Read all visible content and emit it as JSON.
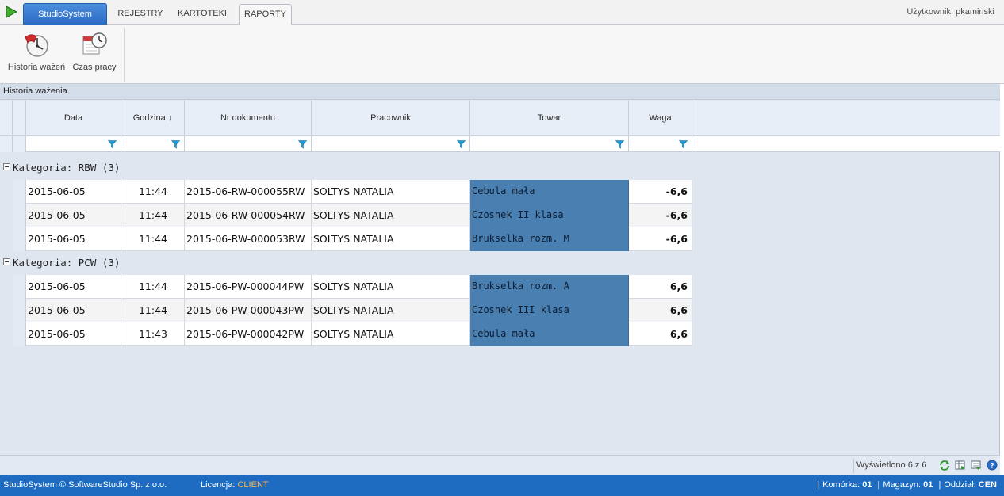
{
  "app": {
    "tabs": {
      "app_label": "StudioSystem",
      "rejestry": "REJESTRY",
      "kartoteki": "KARTOTEKI",
      "raporty": "RAPORTY"
    },
    "user_label": "Użytkownik: pkaminski"
  },
  "ribbon": {
    "historia_label": "Historia ważeń",
    "czas_label": "Czas pracy"
  },
  "panel": {
    "title": "Historia ważenia"
  },
  "grid": {
    "columns": {
      "data": "Data",
      "godzina": "Godzina ↓",
      "nr_dokumentu": "Nr dokumentu",
      "pracownik": "Pracownik",
      "towar": "Towar",
      "waga": "Waga"
    },
    "groups": [
      {
        "label": "Kategoria: RBW (3)",
        "rows": [
          {
            "data": "2015-06-05",
            "godzina": "11:44",
            "nr": "2015-06-RW-000055RW",
            "pracownik": "SOLTYS NATALIA",
            "towar": "Cebula mała",
            "waga": "-6,6"
          },
          {
            "data": "2015-06-05",
            "godzina": "11:44",
            "nr": "2015-06-RW-000054RW",
            "pracownik": "SOLTYS NATALIA",
            "towar": "Czosnek II klasa",
            "waga": "-6,6"
          },
          {
            "data": "2015-06-05",
            "godzina": "11:44",
            "nr": "2015-06-RW-000053RW",
            "pracownik": "SOLTYS NATALIA",
            "towar": "Brukselka rozm. M",
            "waga": "-6,6"
          }
        ]
      },
      {
        "label": "Kategoria: PCW (3)",
        "rows": [
          {
            "data": "2015-06-05",
            "godzina": "11:44",
            "nr": "2015-06-PW-000044PW",
            "pracownik": "SOLTYS NATALIA",
            "towar": "Brukselka rozm. A",
            "waga": "6,6"
          },
          {
            "data": "2015-06-05",
            "godzina": "11:44",
            "nr": "2015-06-PW-000043PW",
            "pracownik": "SOLTYS NATALIA",
            "towar": "Czosnek III klasa",
            "waga": "6,6"
          },
          {
            "data": "2015-06-05",
            "godzina": "11:43",
            "nr": "2015-06-PW-000042PW",
            "pracownik": "SOLTYS NATALIA",
            "towar": "Cebula mała",
            "waga": "6,6"
          }
        ]
      }
    ],
    "shown_label": "Wyświetlono 6 z 6"
  },
  "footer": {
    "copyright": "StudioSystem © SoftwareStudio Sp. z o.o.",
    "licencja_label": "Licencja:",
    "licencja_value": "CLIENT",
    "komorka_label": "Komórka:",
    "komorka_value": "01",
    "magazyn_label": "Magazyn:",
    "magazyn_value": "01",
    "oddzial_label": "Oddział:",
    "oddzial_value": "CEN"
  },
  "colors": {
    "accent": "#1d6cc2",
    "towar_highlight": "#4a7fb2",
    "licencja_value": "#ffb347"
  }
}
